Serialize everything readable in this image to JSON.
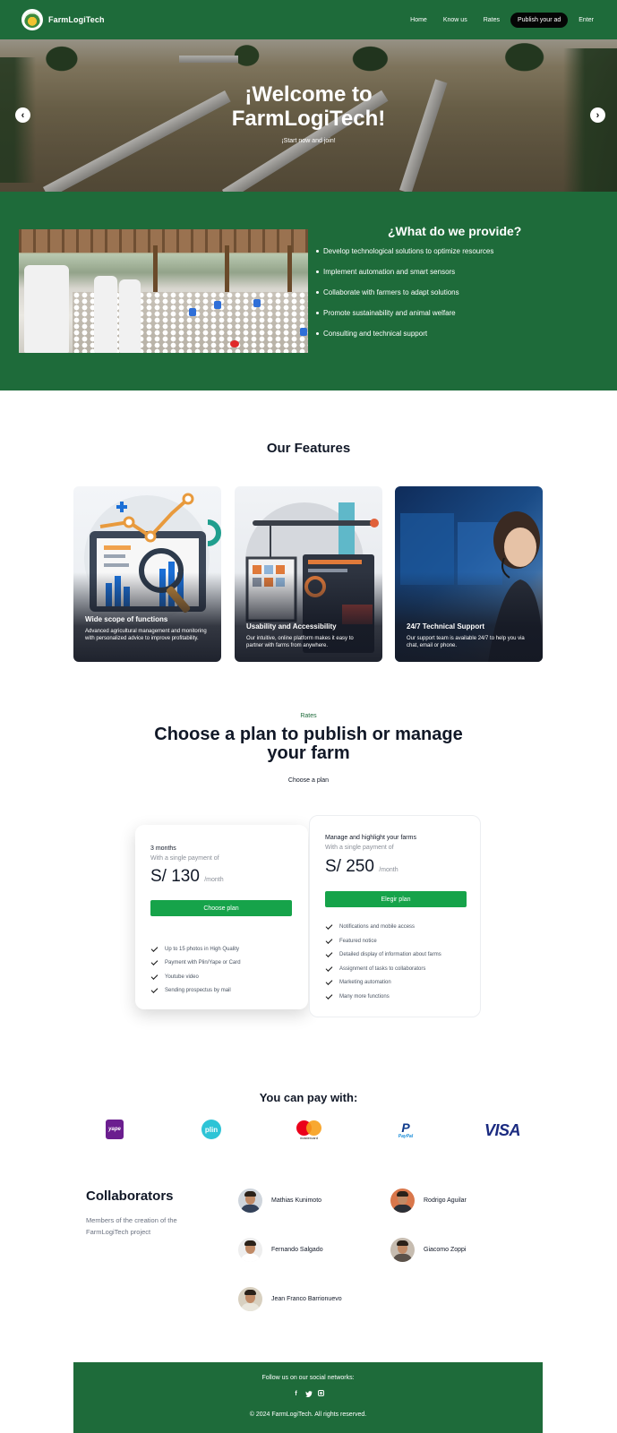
{
  "navbar": {
    "brand": "FarmLogiTech",
    "links": [
      "Home",
      "Know us",
      "Rates"
    ],
    "cta": "Publish your ad",
    "login": "Enter"
  },
  "hero": {
    "title": "¡Welcome to FarmLogiTech!",
    "subtitle": "¡Start now and join!",
    "prev_glyph": "‹",
    "next_glyph": "›"
  },
  "provide": {
    "title": "¿What do we provide?",
    "items": [
      "Develop technological solutions to optimize resources",
      "Implement automation and smart sensors",
      "Collaborate with farmers to adapt solutions",
      "Promote sustainability and animal welfare",
      "Consulting and technical support"
    ]
  },
  "features": {
    "title": "Our Features",
    "cards": [
      {
        "title": "Wide scope of functions",
        "desc": "Advanced agricultural management and monitoring with personalized advice to improve profitability."
      },
      {
        "title": "Usability and Accessibility",
        "desc": "Our intuitive, online platform makes it easy to partner with farms from anywhere."
      },
      {
        "title": "24/7 Technical Support",
        "desc": "Our support team is available 24/7 to help you via chat, email or phone."
      }
    ]
  },
  "rates": {
    "tag": "Rates",
    "title": "Choose a plan to publish or manage your farm",
    "subtitle": "Choose a plan",
    "plans": [
      {
        "name": "3 months",
        "note": "With a single payment of",
        "price": "S/ 130",
        "period": "/month",
        "button": "Choose plan",
        "features": [
          "Up to 15 photos in High Quality",
          "Payment with Plin/Yape or Card",
          "Youtube video",
          "Sending prospectus by mail"
        ]
      },
      {
        "name": "Manage and highlight your farms",
        "note": "With a single payment of",
        "price": "S/ 250",
        "period": "/month",
        "button": "Elegir plan",
        "features": [
          "Notifications and mobile access",
          "Featured notice",
          "Detailed display of information about farms",
          "Assignment of tasks to collaborators",
          "Marketing automation",
          "Many more functions"
        ]
      }
    ]
  },
  "payments": {
    "title": "You can pay with:",
    "yape": "yape",
    "plin": "plin",
    "mastercard": "mastercard",
    "paypal": "PayPal",
    "paypal_mark": "P",
    "visa": "VISA"
  },
  "collaborators": {
    "title": "Collaborators",
    "description": "Members of the creation of the FarmLogiTech project",
    "people": [
      {
        "name": "Mathias Kunimoto",
        "shirt": "#34425a",
        "skin": "#c89474",
        "bg": "#cfd5dc"
      },
      {
        "name": "Rodrigo Aguilar",
        "shirt": "#2b2f36",
        "skin": "#c98d6a",
        "bg": "#d9774b"
      },
      {
        "name": "Fernando Salgado",
        "shirt": "#ffffff",
        "skin": "#c2906e",
        "bg": "#eeeeee"
      },
      {
        "name": "Giacomo Zoppi",
        "shirt": "#5b524a",
        "skin": "#b88a6c",
        "bg": "#c6bcb0"
      },
      {
        "name": "Jean Franco Barrionuevo",
        "shirt": "#e9e6dc",
        "skin": "#c99877",
        "bg": "#d8d0c0"
      }
    ]
  },
  "footer": {
    "follow": "Follow us on our social networks:",
    "facebook": "f",
    "twitter": "t",
    "copyright": "© 2024 FarmLogiTech. All rights reserved."
  },
  "colors": {
    "brand_green": "#1e6b3a",
    "button_green": "#16a34a",
    "cta_black": "#050505"
  }
}
